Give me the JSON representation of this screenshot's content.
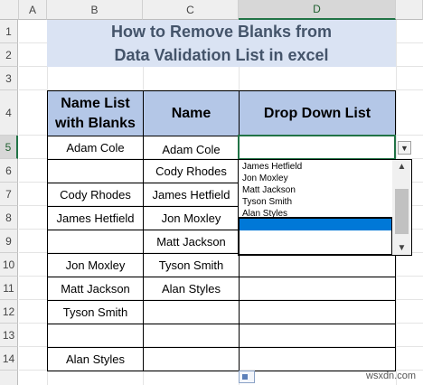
{
  "columns": [
    "A",
    "B",
    "C",
    "D"
  ],
  "rows": [
    "1",
    "2",
    "3",
    "4",
    "5",
    "6",
    "7",
    "8",
    "9",
    "10",
    "11",
    "12",
    "13",
    "14"
  ],
  "title": [
    "How to Remove Blanks from",
    "Data Validation List in excel"
  ],
  "headers": {
    "b": [
      "Name List",
      "with Blanks"
    ],
    "c": "Name",
    "d": "Drop Down List"
  },
  "col_b": [
    "Adam Cole",
    "",
    "Cody Rhodes",
    "James Hetfield",
    "",
    "Jon Moxley",
    "Matt Jackson",
    "Tyson Smith",
    "",
    "Alan Styles"
  ],
  "col_c": [
    "Adam Cole",
    "Cody Rhodes",
    "James Hetfield",
    "Jon Moxley",
    "Matt Jackson",
    "Tyson Smith",
    "Alan Styles",
    "",
    "",
    ""
  ],
  "active_cell_value": "",
  "dropdown_items": [
    "James Hetfield",
    "Jon Moxley",
    "Matt Jackson",
    "Tyson Smith",
    "Alan Styles"
  ],
  "watermark": "wsxdn.com"
}
